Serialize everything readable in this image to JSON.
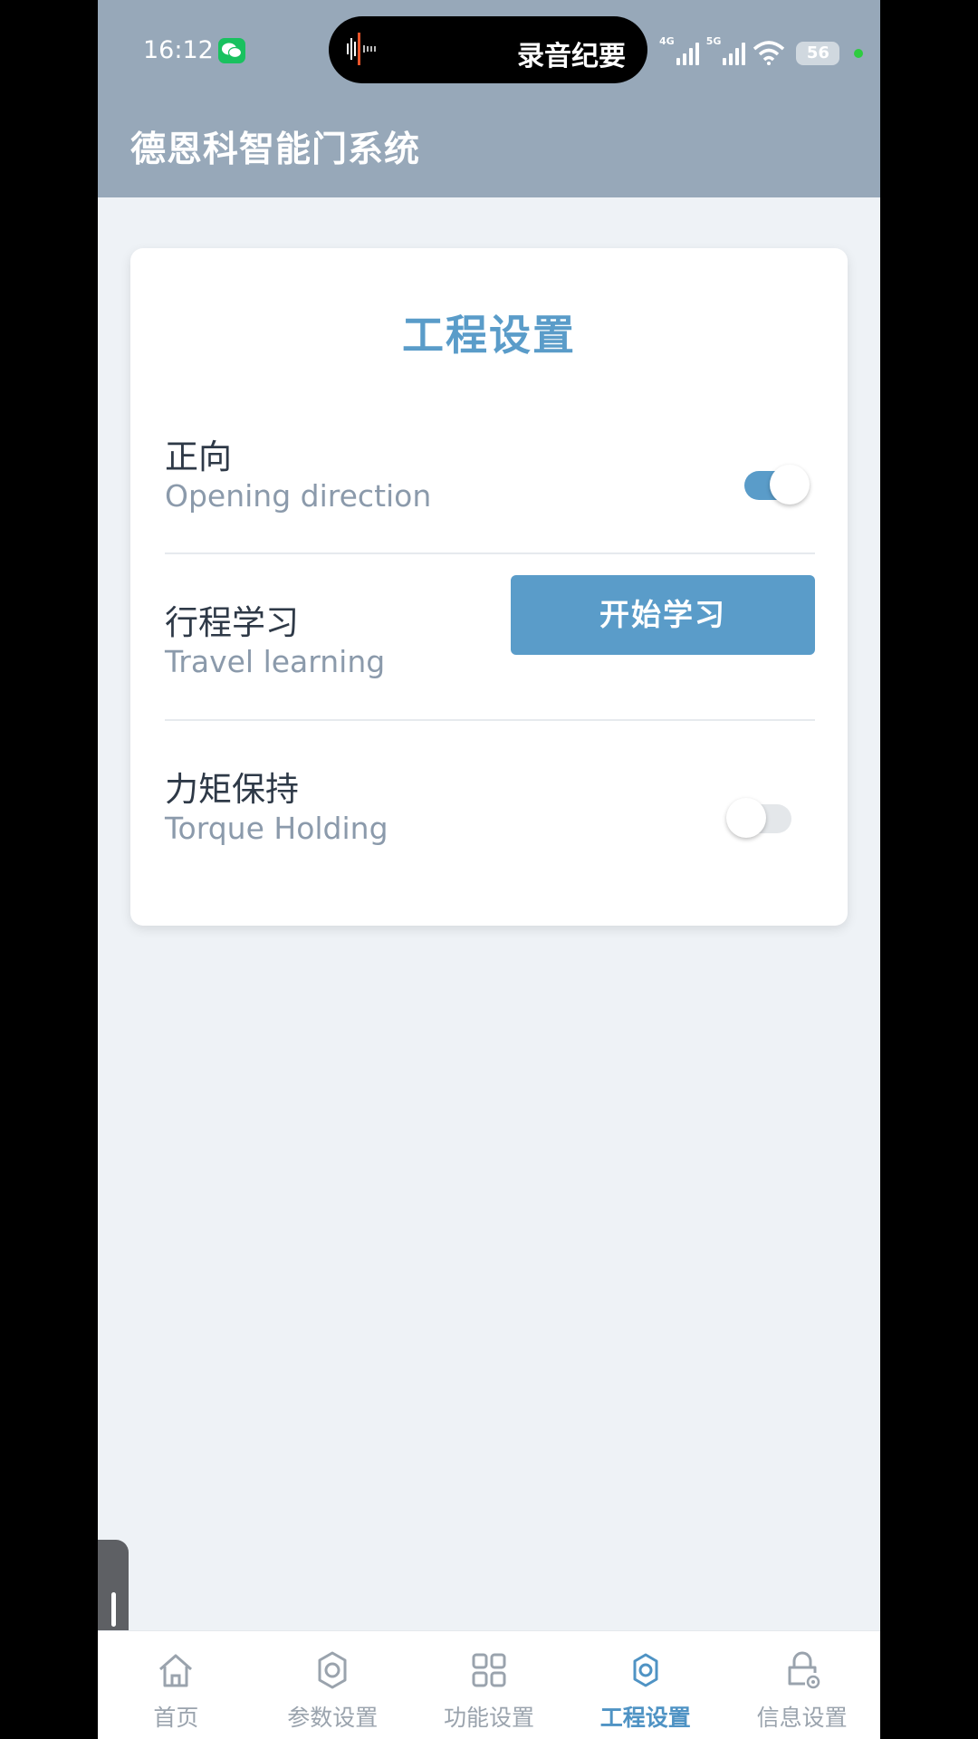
{
  "status_bar": {
    "time": "16:12",
    "island_text": "录音纪要",
    "signal_1": "4G",
    "signal_2": "5G",
    "battery": "56"
  },
  "header": {
    "title": "德恩科智能门系统"
  },
  "card": {
    "title": "工程设置",
    "rows": [
      {
        "label": "正向",
        "sub": "Opening direction",
        "control": "toggle",
        "on": true
      },
      {
        "label": "行程学习",
        "sub": "Travel learning",
        "control": "button",
        "button_label": "开始学习"
      },
      {
        "label": "力矩保持",
        "sub": "Torque Holding",
        "control": "toggle",
        "on": false
      }
    ]
  },
  "bottom_nav": {
    "items": [
      {
        "label": "首页",
        "icon": "home-icon",
        "active": false
      },
      {
        "label": "参数设置",
        "icon": "gear-icon",
        "active": false
      },
      {
        "label": "功能设置",
        "icon": "grid-icon",
        "active": false
      },
      {
        "label": "工程设置",
        "icon": "gear-icon",
        "active": true
      },
      {
        "label": "信息设置",
        "icon": "lock-gear-icon",
        "active": false
      }
    ]
  },
  "colors": {
    "accent": "#5a9cc9",
    "header_bg": "#97a8b9",
    "page_bg": "#eef2f6"
  }
}
